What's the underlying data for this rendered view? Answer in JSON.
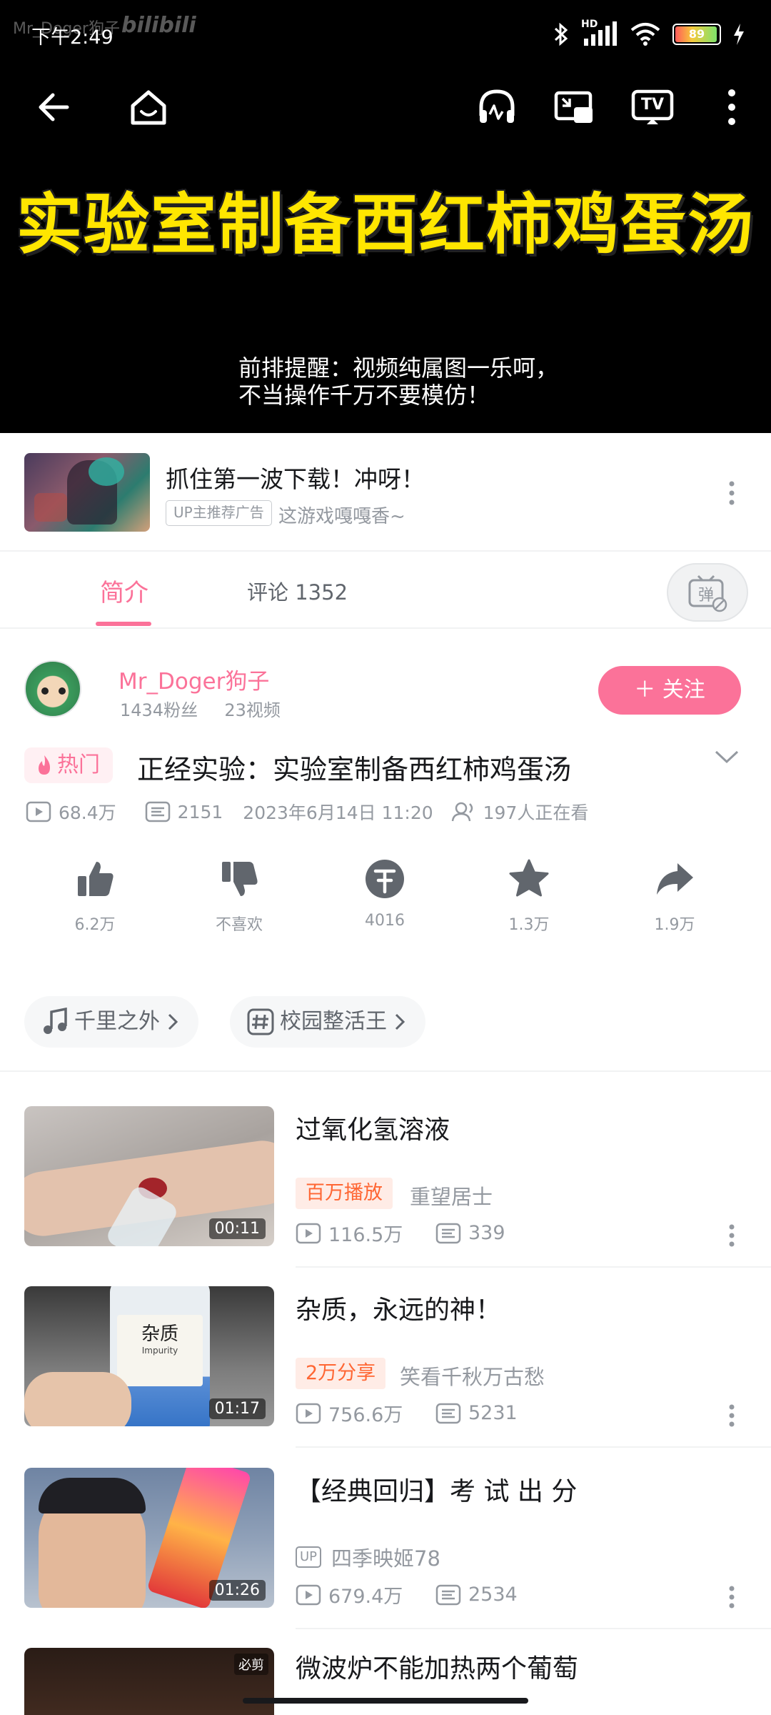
{
  "status": {
    "time": "下午2:49",
    "watermark": "Mr_Doger狗子",
    "watermark_brand": "bilibili",
    "network": "HD",
    "battery": "89"
  },
  "player": {
    "video_title_overlay": "实验室制备西红柿鸡蛋汤",
    "subtitle_line1": "前排提醒：视频纯属图一乐呵，",
    "subtitle_line2": "不当操作千万不要模仿！",
    "tv_label": "TV"
  },
  "ad": {
    "title": "抓住第一波下载！冲呀！",
    "badge": "UP主推荐广告",
    "subtitle": "这游戏嘎嘎香~"
  },
  "tabs": {
    "intro": "简介",
    "comments": "评论 1352",
    "danmaku_icon_char": "弹"
  },
  "uploader": {
    "name": "Mr_Doger狗子",
    "fans": "1434粉丝",
    "videos": "23视频",
    "follow": "＋ 关注"
  },
  "video": {
    "hot_label": "热门",
    "title": "正经实验：实验室制备西红柿鸡蛋汤",
    "views": "68.4万",
    "danmaku": "2151",
    "date": "2023年6月14日  11:20",
    "watching": "197人正在看"
  },
  "actions": {
    "like": "6.2万",
    "dislike": "不喜欢",
    "coin": "4016",
    "favorite": "1.3万",
    "share": "1.9万"
  },
  "tags": [
    {
      "label": "千里之外"
    },
    {
      "label": "校园整活王"
    }
  ],
  "recommendations": [
    {
      "title": "过氧化氢溶液",
      "badge": "百万播放",
      "author": "重望居士",
      "views": "116.5万",
      "danmaku": "339",
      "duration": "00:11"
    },
    {
      "title": "杂质，永远的神！",
      "badge": "2万分享",
      "author": "笑看千秋万古愁",
      "views": "756.6万",
      "danmaku": "5231",
      "duration": "01:17",
      "thumb_text1": "杂质",
      "thumb_text2": "Impurity"
    },
    {
      "title": "【经典回归】考 试 出 分",
      "badge": "",
      "author": "四季映姬78",
      "up_tag": "UP",
      "views": "679.4万",
      "danmaku": "2534",
      "duration": "01:26"
    },
    {
      "title": "微波炉不能加热两个葡萄",
      "thumb_tag": "必剪"
    }
  ],
  "colors": {
    "accent": "#fb7299",
    "title_yellow": "#ffe600",
    "badge_orange": "#ff6633"
  }
}
